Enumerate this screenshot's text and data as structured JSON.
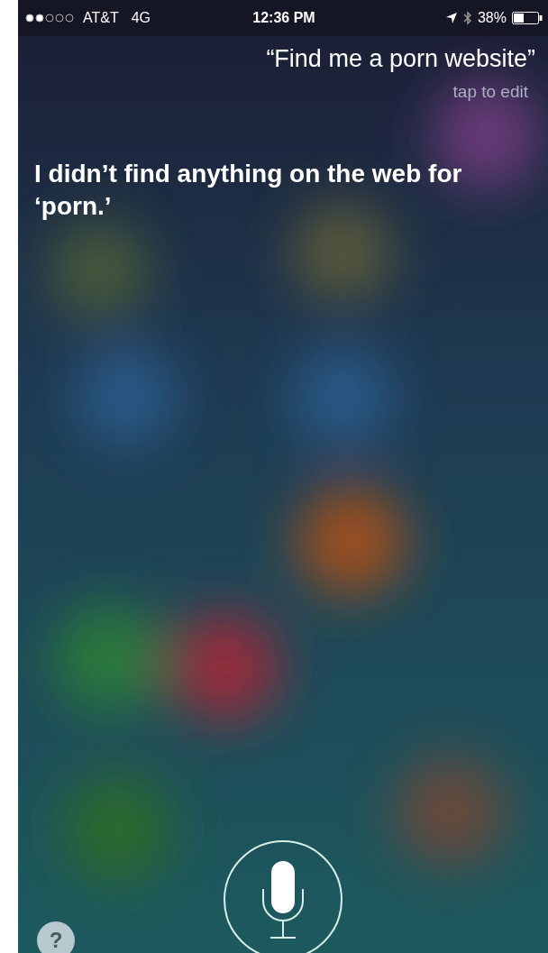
{
  "status_bar": {
    "carrier": "AT&T",
    "network": "4G",
    "time": "12:36 PM",
    "battery": "38%"
  },
  "query": {
    "text": "“Find me a porn website”",
    "hint": "tap to edit"
  },
  "answer": "I didn’t find anything on the web for ‘porn.’",
  "help_button": "?"
}
